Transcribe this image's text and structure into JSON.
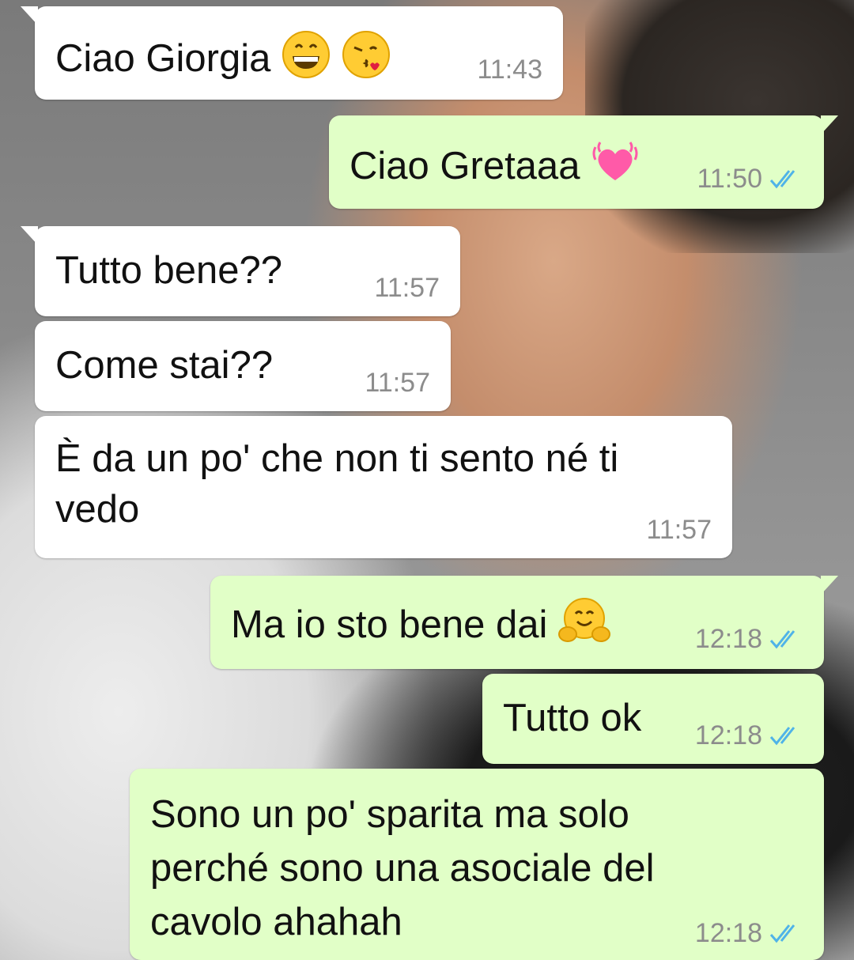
{
  "messages": [
    {
      "text": "Ciao Giorgia",
      "emoji": [
        "grinning-face",
        "face-blowing-kiss"
      ],
      "time": "11:43",
      "direction": "in"
    },
    {
      "text": "Ciao Gretaaa",
      "emoji": [
        "beating-heart"
      ],
      "time": "11:50",
      "direction": "out",
      "read": true
    },
    {
      "text": "Tutto bene??",
      "time": "11:57",
      "direction": "in"
    },
    {
      "text": "Come stai??",
      "time": "11:57",
      "direction": "in"
    },
    {
      "text": "È da un po' che non ti sento né ti vedo",
      "time": "11:57",
      "direction": "in"
    },
    {
      "text": "Ma io sto bene dai",
      "emoji": [
        "hugging-face"
      ],
      "time": "12:18",
      "direction": "out",
      "read": true
    },
    {
      "text": "Tutto ok",
      "time": "12:18",
      "direction": "out",
      "read": true
    },
    {
      "text": "Sono un po' sparita ma solo perché sono una asociale del cavolo ahahah",
      "time": "12:18",
      "direction": "out",
      "read": true
    }
  ],
  "colors": {
    "incoming_bubble": "#ffffff",
    "outgoing_bubble": "#e1ffc7",
    "timestamp": "#8c8c8c",
    "read_ticks": "#4fb3e8"
  }
}
